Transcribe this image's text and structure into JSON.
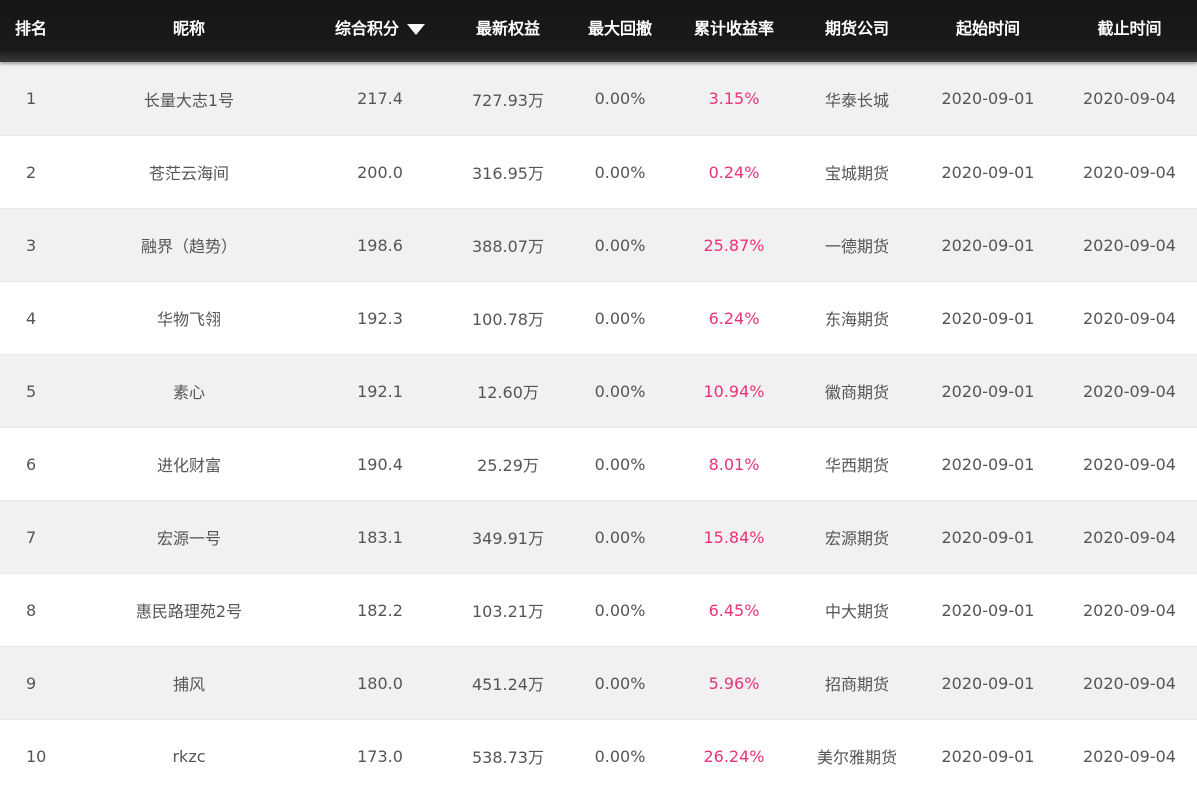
{
  "table": {
    "headers": {
      "rank": "排名",
      "nickname": "昵称",
      "score": "综合积分",
      "equity": "最新权益",
      "drawdown": "最大回撤",
      "return_rate": "累计收益率",
      "company": "期货公司",
      "start": "起始时间",
      "end": "截止时间"
    },
    "sort_icon": "caret-down-icon",
    "return_color": "#e8327a",
    "rows": [
      {
        "rank": "1",
        "nickname": "长量大志1号",
        "score": "217.4",
        "equity": "727.93万",
        "drawdown": "0.00%",
        "return_rate": "3.15%",
        "company": "华泰长城",
        "start": "2020-09-01",
        "end": "2020-09-04"
      },
      {
        "rank": "2",
        "nickname": "苍茫云海间",
        "score": "200.0",
        "equity": "316.95万",
        "drawdown": "0.00%",
        "return_rate": "0.24%",
        "company": "宝城期货",
        "start": "2020-09-01",
        "end": "2020-09-04"
      },
      {
        "rank": "3",
        "nickname": "融界（趋势）",
        "score": "198.6",
        "equity": "388.07万",
        "drawdown": "0.00%",
        "return_rate": "25.87%",
        "company": "一德期货",
        "start": "2020-09-01",
        "end": "2020-09-04"
      },
      {
        "rank": "4",
        "nickname": "华物飞翎",
        "score": "192.3",
        "equity": "100.78万",
        "drawdown": "0.00%",
        "return_rate": "6.24%",
        "company": "东海期货",
        "start": "2020-09-01",
        "end": "2020-09-04"
      },
      {
        "rank": "5",
        "nickname": "素心",
        "score": "192.1",
        "equity": "12.60万",
        "drawdown": "0.00%",
        "return_rate": "10.94%",
        "company": "徽商期货",
        "start": "2020-09-01",
        "end": "2020-09-04"
      },
      {
        "rank": "6",
        "nickname": "进化财富",
        "score": "190.4",
        "equity": "25.29万",
        "drawdown": "0.00%",
        "return_rate": "8.01%",
        "company": "华西期货",
        "start": "2020-09-01",
        "end": "2020-09-04"
      },
      {
        "rank": "7",
        "nickname": "宏源一号",
        "score": "183.1",
        "equity": "349.91万",
        "drawdown": "0.00%",
        "return_rate": "15.84%",
        "company": "宏源期货",
        "start": "2020-09-01",
        "end": "2020-09-04"
      },
      {
        "rank": "8",
        "nickname": "惠民路理苑2号",
        "score": "182.2",
        "equity": "103.21万",
        "drawdown": "0.00%",
        "return_rate": "6.45%",
        "company": "中大期货",
        "start": "2020-09-01",
        "end": "2020-09-04"
      },
      {
        "rank": "9",
        "nickname": "捕风",
        "score": "180.0",
        "equity": "451.24万",
        "drawdown": "0.00%",
        "return_rate": "5.96%",
        "company": "招商期货",
        "start": "2020-09-01",
        "end": "2020-09-04"
      },
      {
        "rank": "10",
        "nickname": "rkzc",
        "score": "173.0",
        "equity": "538.73万",
        "drawdown": "0.00%",
        "return_rate": "26.24%",
        "company": "美尔雅期货",
        "start": "2020-09-01",
        "end": "2020-09-04"
      }
    ]
  }
}
